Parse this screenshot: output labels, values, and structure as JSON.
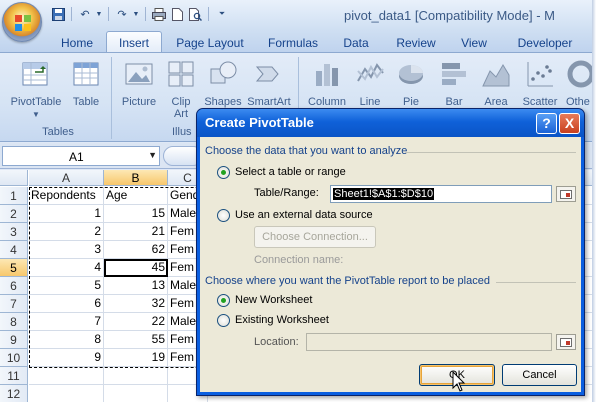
{
  "window": {
    "title": "pivot_data1  [Compatibility Mode]  -  M"
  },
  "qat": {
    "icons": [
      "save-icon",
      "undo-icon",
      "redo-icon",
      "print-icon",
      "new-icon",
      "print-preview-icon",
      "customize-icon"
    ]
  },
  "tabs": [
    "Home",
    "Insert",
    "Page Layout",
    "Formulas",
    "Data",
    "Review",
    "View",
    "Developer"
  ],
  "active_tab": "Insert",
  "ribbon": {
    "buttons": [
      "PivotTable",
      "Table",
      "Picture",
      "Clip Art",
      "Shapes",
      "SmartArt",
      "Column",
      "Line",
      "Pie",
      "Bar",
      "Area",
      "Scatter",
      "Othe"
    ],
    "clip_art_line1": "Clip",
    "clip_art_line2": "Art",
    "groups": [
      "Tables",
      "Illus"
    ]
  },
  "formula_bar": {
    "name_box": "A1"
  },
  "sheet": {
    "columns": [
      "A",
      "B",
      "C"
    ],
    "rows": [
      "1",
      "2",
      "3",
      "4",
      "5",
      "6",
      "7",
      "8",
      "9",
      "10",
      "11",
      "12"
    ],
    "cells": [
      [
        "Repondents",
        "Age",
        "Gend"
      ],
      [
        "1",
        "15",
        "Male"
      ],
      [
        "2",
        "21",
        "Fem"
      ],
      [
        "3",
        "62",
        "Fem"
      ],
      [
        "4",
        "45",
        "Fem"
      ],
      [
        "5",
        "13",
        "Male"
      ],
      [
        "6",
        "32",
        "Fem"
      ],
      [
        "7",
        "22",
        "Male"
      ],
      [
        "8",
        "55",
        "Fem"
      ],
      [
        "9",
        "19",
        "Fem"
      ],
      [
        "",
        "",
        ""
      ],
      [
        "",
        "",
        ""
      ]
    ]
  },
  "dialog": {
    "title": "Create PivotTable",
    "help": "?",
    "close": "X",
    "section1": "Choose the data that you want to analyze",
    "opt_select_table": "Select a table or range",
    "table_range_label": "Table/Range:",
    "table_range_value": "Sheet1!$A$1:$D$10",
    "opt_external": "Use an external data source",
    "choose_connection": "Choose Connection...",
    "connection_name_label": "Connection name:",
    "section2": "Choose where you want the PivotTable report to be placed",
    "opt_new_ws": "New Worksheet",
    "opt_existing_ws": "Existing Worksheet",
    "location_label": "Location:",
    "location_value": "",
    "ok": "OK",
    "cancel": "Cancel"
  }
}
